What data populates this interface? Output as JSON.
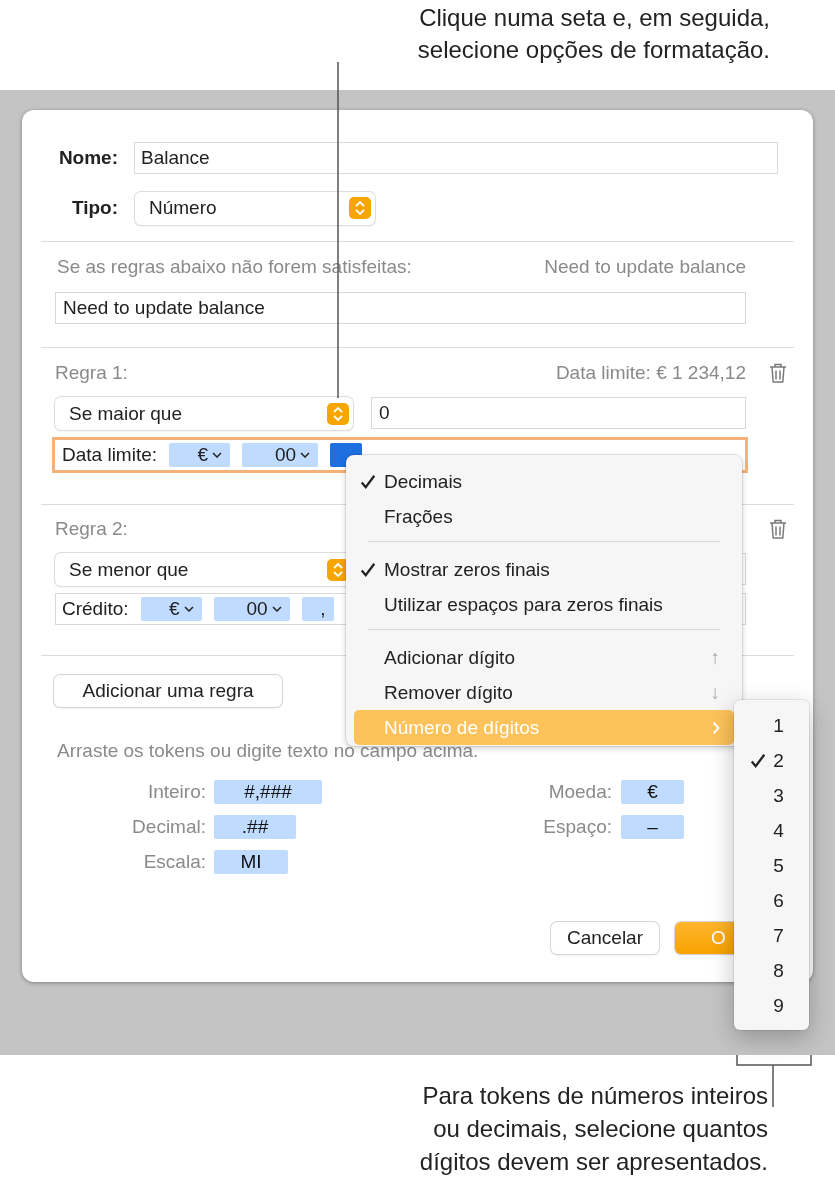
{
  "callouts": [
    {
      "lines": [
        "Clique numa seta e, em seguida,",
        "selecione opções de formatação."
      ]
    },
    {
      "lines": [
        "Para tokens de números inteiros",
        "ou decimais, selecione quantos",
        "dígitos devem ser apresentados."
      ]
    }
  ],
  "dialog": {
    "name": {
      "label": "Nome:",
      "value": "Balance"
    },
    "type": {
      "label": "Tipo:",
      "value": "Número"
    },
    "failed_label": "Se as regras abaixo não forem satisfeitas:",
    "failed_preview": "Need to update balance",
    "failed_value": "Need to update balance",
    "rules": [
      {
        "title": "Regra 1:",
        "preview": "Data limite: € 1 234,12",
        "condition": "Se maior que",
        "value": "0",
        "focused": true,
        "format_label": "Data limite:",
        "tokens": [
          {
            "text": "€",
            "selected": false,
            "has_menu": true
          },
          {
            "text": "00",
            "selected": false,
            "has_menu": true
          },
          {
            "selected": true,
            "has_menu": false
          }
        ]
      },
      {
        "title": "Regra 2:",
        "condition": "Se menor que",
        "focused": false,
        "format_label": "Crédito:",
        "tokens": [
          {
            "text": "€",
            "selected": false,
            "has_menu": true
          },
          {
            "text": "00",
            "selected": false,
            "has_menu": true
          },
          {
            "text": ",",
            "selected": false,
            "has_menu": false
          }
        ]
      }
    ],
    "add_rule": "Adicionar uma regra",
    "hint": "Arraste os tokens ou digite texto no campo acima.",
    "legend_left": [
      {
        "label": "Inteiro:",
        "token": "#,###"
      },
      {
        "label": "Decimal:",
        "token": ".##"
      },
      {
        "label": "Escala:",
        "token": "MI"
      }
    ],
    "legend_right": [
      {
        "label": "Moeda:",
        "token": "€"
      },
      {
        "label": "Espaço:",
        "token": "–"
      }
    ],
    "buttons": [
      {
        "label": "Cancelar",
        "kind": "default"
      },
      {
        "label": "O",
        "kind": "primary"
      }
    ]
  },
  "menu": {
    "items": [
      {
        "kind": "item",
        "label": "Decimais",
        "checked": true,
        "selected": false
      },
      {
        "kind": "item",
        "label": "Frações",
        "checked": false,
        "selected": false
      },
      {
        "kind": "separator"
      },
      {
        "kind": "item",
        "label": "Mostrar zeros finais",
        "checked": true,
        "selected": false
      },
      {
        "kind": "item",
        "label": "Utilizar espaços para zeros finais",
        "checked": false,
        "selected": false
      },
      {
        "kind": "separator"
      },
      {
        "kind": "item",
        "label": "Adicionar dígito",
        "checked": false,
        "selected": false,
        "shortcut": "↑"
      },
      {
        "kind": "item",
        "label": "Remover dígito",
        "checked": false,
        "selected": false,
        "shortcut": "↓"
      },
      {
        "kind": "item",
        "label": "Número de dígitos",
        "checked": false,
        "selected": true,
        "has_submenu": true
      }
    ]
  },
  "submenu": {
    "items": [
      {
        "label": "1",
        "checked": false
      },
      {
        "label": "2",
        "checked": true
      },
      {
        "label": "3",
        "checked": false
      },
      {
        "label": "4",
        "checked": false
      },
      {
        "label": "5",
        "checked": false
      },
      {
        "label": "6",
        "checked": false
      },
      {
        "label": "7",
        "checked": false
      },
      {
        "label": "8",
        "checked": false
      },
      {
        "label": "9",
        "checked": false
      }
    ]
  }
}
